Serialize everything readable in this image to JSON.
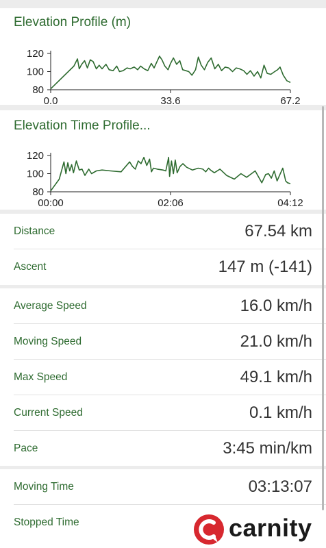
{
  "elevation_profile": {
    "title": "Elevation Profile (m)"
  },
  "elevation_time_profile": {
    "title": "Elevation Time Profile..."
  },
  "chart_data": [
    {
      "type": "line",
      "title": "Elevation Profile (m)",
      "xlabel": "",
      "ylabel": "",
      "xlim": [
        0,
        67.2
      ],
      "ylim": [
        80,
        120
      ],
      "x_tick_labels": [
        "0.0",
        "33.6",
        "67.2"
      ],
      "y_tick_labels": [
        "80",
        "100",
        "120"
      ],
      "grid": false,
      "line_color": "#2e6b30",
      "series": [
        {
          "x": [
            0,
            6.5,
            7.5,
            8.0,
            8.7,
            9.5,
            10.3,
            11.1,
            11.9,
            12.8,
            13.6,
            14.4,
            15.5,
            16.4,
            17.5,
            18.5,
            19.3,
            20.3,
            21.4,
            22.3,
            23.4,
            24.4,
            25.2,
            26.2,
            27.2,
            28.2,
            29.0,
            29.8,
            30.5,
            31.2,
            32.0,
            32.9,
            33.6,
            34.4,
            35.3,
            36.2,
            37.0,
            37.9,
            38.7,
            39.6,
            40.6,
            41.4,
            42.2,
            43.1,
            44.0,
            45.0,
            46.0,
            47.0,
            47.9,
            48.9,
            49.9,
            51.0,
            52.0,
            53.0,
            54.1,
            55.0,
            56.0,
            57.0,
            58.0,
            58.9,
            59.8,
            60.7,
            61.7,
            62.8,
            63.6,
            64.3,
            65.2,
            66.2,
            67.2
          ],
          "y": [
            81,
            106,
            114,
            103,
            108,
            112,
            104,
            113,
            111,
            103,
            107,
            103,
            108,
            102,
            101,
            106,
            100,
            101,
            104,
            103,
            105,
            102,
            106,
            103,
            101,
            109,
            104,
            111,
            117,
            113,
            106,
            102,
            109,
            115,
            108,
            112,
            102,
            101,
            100,
            96,
            102,
            116,
            107,
            102,
            110,
            115,
            103,
            108,
            101,
            105,
            104,
            100,
            104,
            103,
            101,
            97,
            101,
            95,
            100,
            93,
            107,
            98,
            97,
            100,
            102,
            105,
            96,
            90,
            88
          ]
        }
      ]
    },
    {
      "type": "line",
      "title": "Elevation Time Profile...",
      "xlabel": "",
      "ylabel": "",
      "xlim": [
        "00:00",
        "04:12"
      ],
      "ylim": [
        80,
        120
      ],
      "x_tick_labels": [
        "00:00",
        "02:06",
        "04:12"
      ],
      "y_tick_labels": [
        "80",
        "100",
        "120"
      ],
      "grid": false,
      "line_color": "#2e6b30",
      "series": [
        {
          "x_minutes": [
            0,
            9,
            14,
            16,
            18,
            20,
            22,
            24,
            27,
            30,
            33,
            36,
            40,
            43,
            48,
            54,
            63,
            74,
            83,
            86,
            89,
            92,
            95,
            98,
            101,
            104,
            106,
            108,
            112,
            118,
            121,
            124,
            125,
            127,
            129,
            131,
            133,
            136,
            139,
            143,
            149,
            155,
            160,
            163,
            166,
            168,
            172,
            178,
            185,
            193,
            200,
            206,
            215,
            222,
            226,
            229,
            232,
            235,
            238,
            241,
            244,
            247,
            249,
            252
          ],
          "y": [
            81,
            94,
            113,
            100,
            112,
            103,
            110,
            101,
            114,
            104,
            105,
            98,
            105,
            100,
            103,
            104,
            103,
            102,
            113,
            108,
            105,
            114,
            111,
            118,
            109,
            116,
            102,
            106,
            105,
            104,
            103,
            118,
            97,
            114,
            100,
            115,
            101,
            108,
            111,
            107,
            104,
            106,
            105,
            102,
            106,
            104,
            101,
            105,
            98,
            94,
            100,
            96,
            103,
            90,
            99,
            100,
            95,
            103,
            92,
            99,
            106,
            92,
            90,
            89
          ]
        }
      ]
    }
  ],
  "stats_group_1": [
    {
      "label": "Distance",
      "value": "67.54 km"
    },
    {
      "label": "Ascent",
      "value": "147 m (-141)"
    }
  ],
  "stats_group_2": [
    {
      "label": "Average Speed",
      "value": "16.0 km/h"
    },
    {
      "label": "Moving Speed",
      "value": "21.0 km/h"
    },
    {
      "label": "Max Speed",
      "value": "49.1 km/h"
    },
    {
      "label": "Current Speed",
      "value": "0.1 km/h"
    },
    {
      "label": "Pace",
      "value": "3:45 min/km"
    }
  ],
  "stats_group_3": [
    {
      "label": "Moving Time",
      "value": "03:13:07"
    },
    {
      "label": "Stopped Time",
      "value": ""
    }
  ],
  "watermark": {
    "text": "carnity",
    "color": "#d7282f"
  },
  "colors": {
    "accent": "#2e6b30",
    "value_text": "#333333",
    "background": "#ececec",
    "card": "#ffffff"
  }
}
